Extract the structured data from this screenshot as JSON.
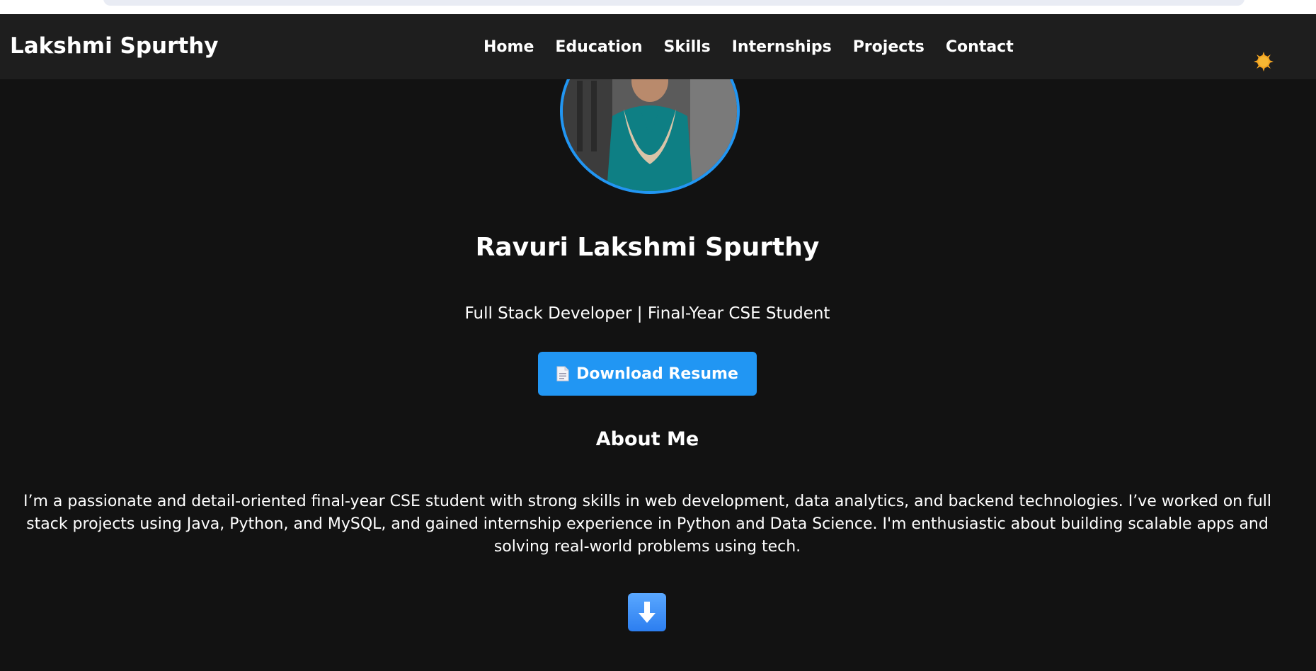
{
  "navbar": {
    "brand": "Lakshmi Spurthy",
    "links": [
      {
        "label": "Home"
      },
      {
        "label": "Education"
      },
      {
        "label": "Skills"
      },
      {
        "label": "Internships"
      },
      {
        "label": "Projects"
      },
      {
        "label": "Contact"
      }
    ],
    "theme_toggle_icon": "sun-icon"
  },
  "hero": {
    "name": "Ravuri Lakshmi Spurthy",
    "tagline": "Full Stack Developer | Final-Year CSE Student",
    "resume_button": "Download Resume",
    "resume_icon": "document-icon"
  },
  "about": {
    "heading": "About Me",
    "text": "I’m a passionate and detail-oriented final-year CSE student with strong skills in web development, data analytics, and backend technologies. I’ve worked on full stack projects using Java, Python, and MySQL, and gained internship experience in Python and Data Science. I'm enthusiastic about building scalable apps and solving real-world problems using tech."
  },
  "scroll_down_icon": "down-arrow-icon",
  "colors": {
    "background": "#121212",
    "navbar": "#1e1e1e",
    "accent": "#2196f3",
    "sun": "#f5a623"
  }
}
